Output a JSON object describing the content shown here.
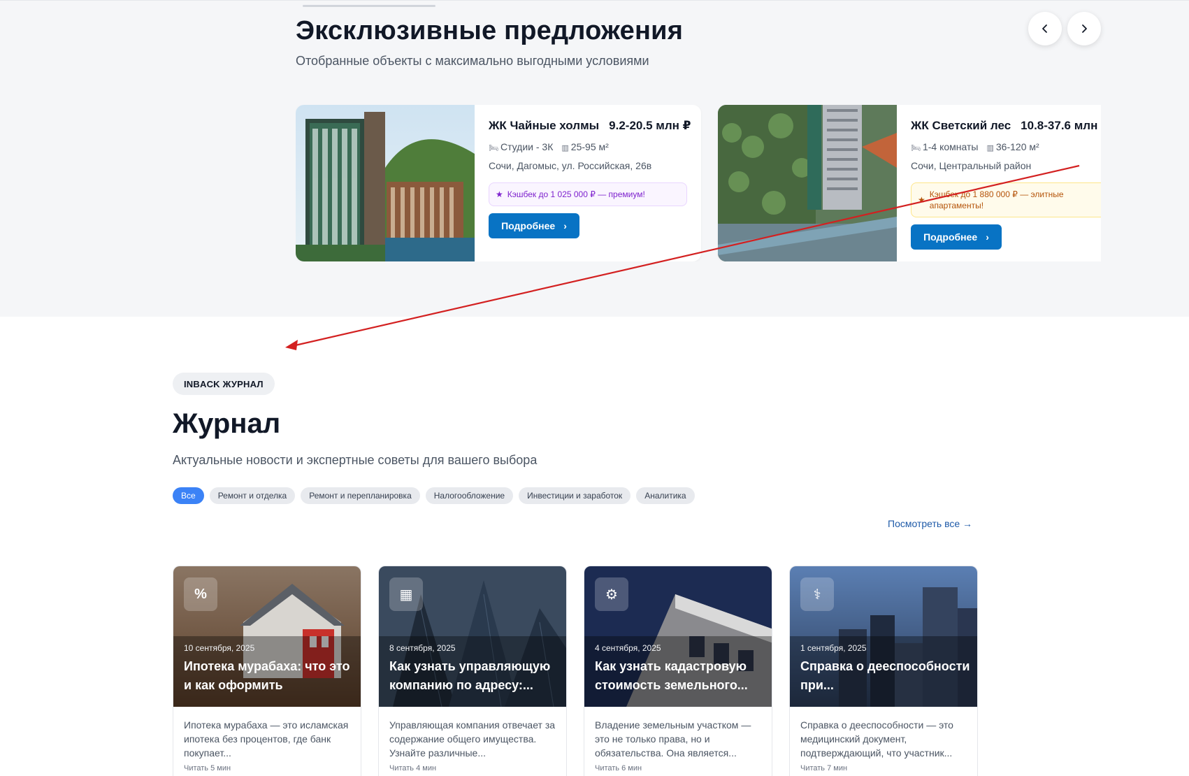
{
  "exclusive": {
    "title": "Эксклюзивные предложения",
    "subtitle": "Отобранные объекты с максимально выгодными условиями",
    "prev_icon": "chevron-left-icon",
    "next_icon": "chevron-right-icon",
    "offers": [
      {
        "name": "ЖК Чайные холмы",
        "price": "9.2-20.5 млн ₽",
        "rooms": "Студии - 3К",
        "area": "25-95 м²",
        "address": "Сочи, Дагомыс, ул. Российская, 26в",
        "badge": "Кэшбек до 1 025 000 ₽ — премиум!",
        "button": "Подробнее"
      },
      {
        "name": "ЖК Светский лес",
        "price": "10.8-37.6 млн",
        "rooms": "1-4 комнаты",
        "area": "36-120 м²",
        "address": "Сочи, Центральный район",
        "badge": "Кэшбек до 1 880 000 ₽ — элитные апартаменты!",
        "button": "Подробнее"
      }
    ]
  },
  "journal": {
    "chip": "INBACK ЖУРНАЛ",
    "title": "Журнал",
    "subtitle": "Актуальные новости и экспертные советы для вашего выбора",
    "filters": [
      "Все",
      "Ремонт и отделка",
      "Ремонт и перепланировка",
      "Налогообложение",
      "Инвестиции и заработок",
      "Аналитика"
    ],
    "active_filter": "Все",
    "see_all": "Посмотреть все →",
    "articles": [
      {
        "icon": "percent-icon",
        "date": "10 сентября, 2025",
        "title": "Ипотека мурабаха: что это и как оформить",
        "excerpt": "Ипотека мурабаха — это исламская ипотека без процентов, где банк покупает...",
        "read": "Читать 5 мин"
      },
      {
        "icon": "building-icon",
        "date": "8 сентября, 2025",
        "title": "Как узнать управляющую компанию по адресу:...",
        "excerpt": "Управляющая компания отвечает за содержание общего имущества. Узнайте различные...",
        "read": "Читать 4 мин"
      },
      {
        "icon": "tractor-icon",
        "date": "4 сентября, 2025",
        "title": "Как узнать кадастровую стоимость земельного...",
        "excerpt": "Владение земельным участком — это не только права, но и обязательства. Она является...",
        "read": "Читать 6 мин"
      },
      {
        "icon": "stethoscope-icon",
        "date": "1 сентября, 2025",
        "title": "Справка о дееспособности при...",
        "excerpt": "Справка о дееспособности — это медицинский документ, подтверждающий, что участник...",
        "read": "Читать 7 мин"
      }
    ]
  },
  "colors": {
    "accent_button": "#0873c4",
    "active_filter": "#3b82f6",
    "annotation_arrow": "#d32020"
  }
}
